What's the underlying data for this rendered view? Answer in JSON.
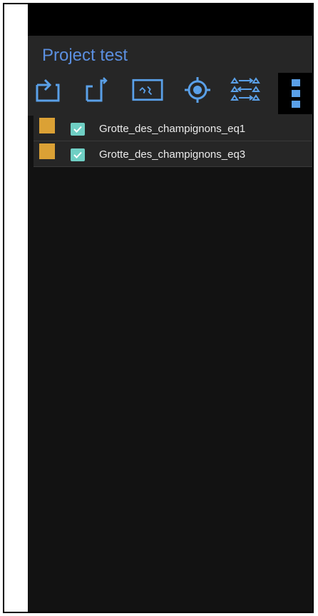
{
  "app": {
    "title": "Project test"
  },
  "toolbar": {
    "icons": [
      "layer-up-icon",
      "layer-import-icon",
      "map-view-icon",
      "locate-target-icon",
      "triangulation-icon",
      "more-options-icon"
    ]
  },
  "layers": [
    {
      "name": "Grotte_des_champignons_eq1",
      "checked": true,
      "color": "#dba135"
    },
    {
      "name": "Grotte_des_champignons_eq3",
      "checked": true,
      "color": "#dba135"
    }
  ],
  "colors": {
    "accent": "#5b8fe0",
    "toolbar_icon": "#5aa0e8",
    "checkbox": "#6fcfc4",
    "layer_swatch": "#dba135"
  }
}
